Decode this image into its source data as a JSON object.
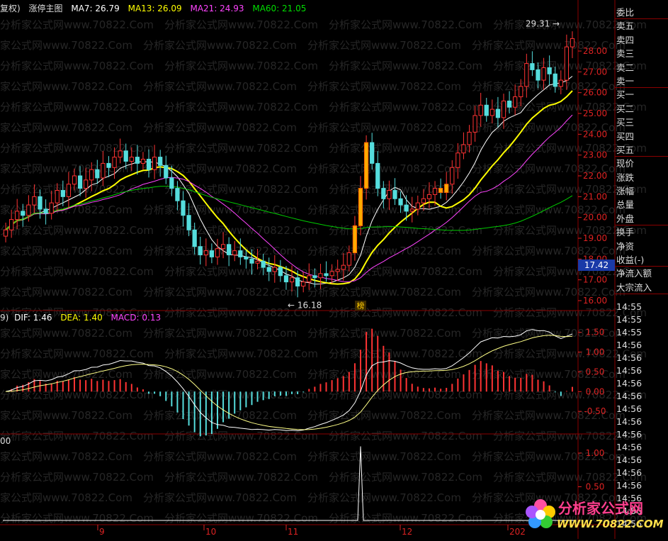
{
  "main_title": {
    "prefix": "复权)",
    "indicator": "涨停主图",
    "ma7": "MA7: 26.79",
    "ma13": "MA13: 26.09",
    "ma21": "MA21: 24.93",
    "ma60": "MA60: 21.05"
  },
  "macd_title": {
    "prefix": "9)",
    "dif": "DIF: 1.46",
    "dea": "DEA: 1.40",
    "macd": "MACD: 0.13"
  },
  "third_title": "00",
  "annotations": {
    "high_label": "29.31",
    "low_label": "16.18",
    "bang_label": "榜",
    "price_marker": "17.42"
  },
  "side_panel": {
    "top_items": [
      "委比",
      "卖五",
      "卖四",
      "卖三",
      "卖二",
      "卖一",
      "买一",
      "买二",
      "买三",
      "买四",
      "买五",
      "现价",
      "涨跌",
      "涨幅",
      "总量",
      "外盘",
      "换手",
      "净资",
      "收益(-)",
      "净流入额",
      "大宗流入"
    ],
    "times": [
      "14:55",
      "14:55",
      "14:55",
      "14:56",
      "14:56",
      "14:56",
      "14:56",
      "14:56",
      "14:56",
      "14:56",
      "14:56",
      "14:56",
      "14:56",
      "14:56",
      "14:56",
      "14:56",
      "14:56",
      "14:56"
    ]
  },
  "x_axis_months": [
    "9",
    "10",
    "11",
    "12",
    "202"
  ],
  "logo": {
    "title": "分析家公式网",
    "url": "WWW.70822.COM"
  },
  "watermark": "分析家公式网www.70822.Com",
  "chart_data": [
    {
      "type": "candlestick",
      "title": "涨停主图",
      "ylim": [
        16.0,
        29.5
      ],
      "y_ticks": [
        16.0,
        17.0,
        18.0,
        19.0,
        20.0,
        21.0,
        22.0,
        23.0,
        24.0,
        25.0,
        26.0,
        27.0,
        28.0
      ],
      "ma_series": [
        {
          "name": "MA7",
          "last": 26.79,
          "color": "#ffffff"
        },
        {
          "name": "MA13",
          "last": 26.09,
          "color": "#ffff00"
        },
        {
          "name": "MA21",
          "last": 24.93,
          "color": "#ff44ff"
        },
        {
          "name": "MA60",
          "last": 21.05,
          "color": "#00cc00"
        }
      ],
      "close": [
        19.4,
        19.9,
        20.3,
        20.1,
        20.6,
        21.0,
        20.4,
        20.2,
        20.7,
        21.3,
        21.0,
        21.6,
        22.0,
        21.4,
        21.8,
        22.3,
        21.9,
        22.6,
        22.4,
        22.9,
        23.2,
        22.7,
        22.9,
        22.6,
        22.8,
        22.3,
        22.9,
        22.5,
        21.9,
        21.4,
        20.8,
        20.1,
        19.4,
        18.6,
        18.2,
        18.4,
        18.1,
        18.5,
        18.7,
        18.2,
        18.4,
        18.1,
        18.0,
        17.8,
        17.9,
        17.6,
        17.4,
        17.6,
        17.2,
        16.9,
        17.1,
        16.7,
        16.9,
        17.2,
        17.1,
        17.3,
        17.2,
        17.4,
        17.5,
        17.7,
        18.3,
        19.6,
        21.4,
        23.6,
        22.6,
        21.4,
        20.9,
        21.3,
        20.9,
        20.6,
        20.3,
        20.4,
        20.7,
        20.9,
        21.1,
        21.4,
        21.2,
        21.6,
        22.4,
        23.1,
        23.5,
        24.1,
        24.9,
        25.4,
        24.9,
        25.2,
        24.8,
        25.6,
        25.3,
        25.8,
        26.3,
        27.4,
        27.1,
        26.6,
        27.2,
        26.9,
        26.3,
        26.6,
        28.2,
        28.6
      ],
      "open": [
        19.1,
        19.4,
        19.9,
        20.3,
        20.1,
        20.6,
        21.0,
        20.4,
        20.2,
        20.7,
        21.3,
        21.0,
        21.6,
        22.0,
        21.4,
        21.8,
        22.3,
        21.9,
        22.6,
        22.4,
        22.9,
        23.2,
        22.7,
        22.9,
        22.6,
        22.8,
        22.3,
        22.9,
        22.5,
        21.9,
        21.4,
        20.8,
        20.1,
        19.4,
        18.6,
        18.2,
        18.4,
        18.1,
        18.5,
        18.7,
        18.2,
        18.4,
        18.1,
        18.0,
        17.8,
        17.9,
        17.6,
        17.4,
        17.6,
        17.2,
        16.9,
        17.1,
        16.7,
        16.9,
        17.2,
        17.1,
        17.3,
        17.2,
        17.4,
        17.5,
        17.7,
        18.3,
        19.6,
        21.4,
        23.6,
        22.6,
        21.4,
        20.9,
        21.3,
        20.9,
        20.6,
        20.3,
        20.4,
        20.7,
        20.9,
        21.1,
        21.4,
        21.2,
        21.6,
        22.4,
        23.1,
        23.5,
        24.1,
        24.9,
        25.4,
        24.9,
        25.2,
        24.8,
        25.6,
        25.3,
        25.8,
        26.3,
        27.4,
        27.1,
        26.6,
        27.2,
        26.9,
        26.3,
        26.6,
        28.2
      ],
      "limit_up_bars": [
        61,
        62,
        63,
        76,
        77
      ],
      "high_point": 29.31,
      "low_point": 16.18
    },
    {
      "type": "bar",
      "title": "MACD",
      "ylim": [
        -1.0,
        1.8
      ],
      "y_ticks": [
        1.5,
        1.0,
        0.5,
        0.0,
        -0.5
      ],
      "series": [
        {
          "name": "DIF",
          "last": 1.46
        },
        {
          "name": "DEA",
          "last": 1.4
        },
        {
          "name": "MACD",
          "last": 0.13
        }
      ]
    },
    {
      "type": "line",
      "ylim": [
        0.0,
        1.2
      ],
      "y_ticks": [
        1.0,
        0.5
      ]
    }
  ]
}
